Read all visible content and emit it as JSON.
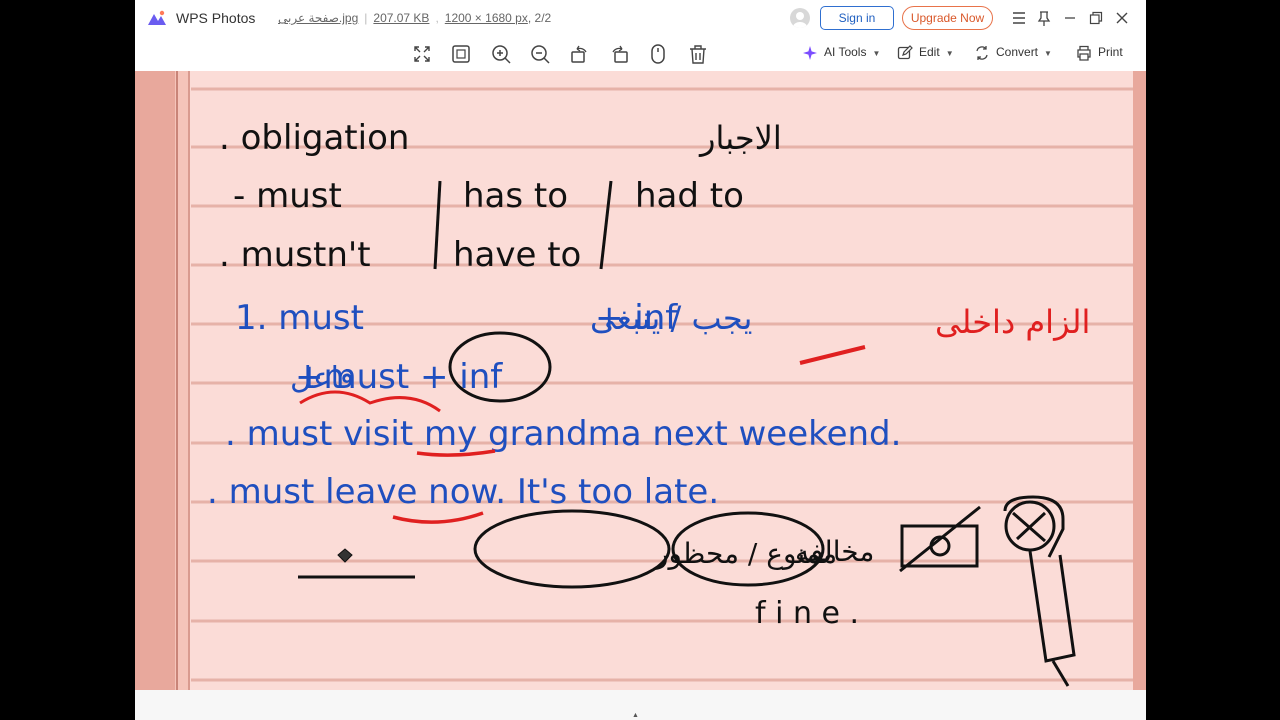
{
  "app": {
    "name": "WPS Photos"
  },
  "file": {
    "name": "صفحة عربى.jpg",
    "size": "207.07 KB",
    "dimensions": "1200 × 1680 px",
    "page": "2/2"
  },
  "header": {
    "signin_label": "Sign in",
    "upgrade_label": "Upgrade Now"
  },
  "toolbar": {
    "ai_tools": "AI Tools",
    "edit": "Edit",
    "convert": "Convert",
    "print": "Print"
  },
  "note": {
    "line1_en": ". obligation",
    "line1_ar": "الاجبار",
    "line2_a": "- must",
    "line2_b": "has to",
    "line2_c": "had to",
    "line3_a": ". mustn't",
    "line3_b": "have to",
    "line4_en": "1. must",
    "line4_ar": "يجب / ينبغى",
    "line4_plus": "+ inf",
    "line4_red": "الزام داخلى",
    "line5_ar": "فاعل",
    "line5_en": "+must + inf",
    "line6": ". must visit my grandma next weekend.",
    "line7": ". must leave now. It's too late.",
    "circle1": "ممنوع / محظور",
    "circle2": "مخالفه",
    "fine": "f i n e ."
  },
  "colors": {
    "paper": "#fbdcd7",
    "line": "#e9b6ad",
    "ink_black": "#111111",
    "ink_blue": "#1f4fbf",
    "ink_red": "#e02020",
    "accent_blue": "#2f6fd0",
    "accent_orange": "#e8734a"
  }
}
